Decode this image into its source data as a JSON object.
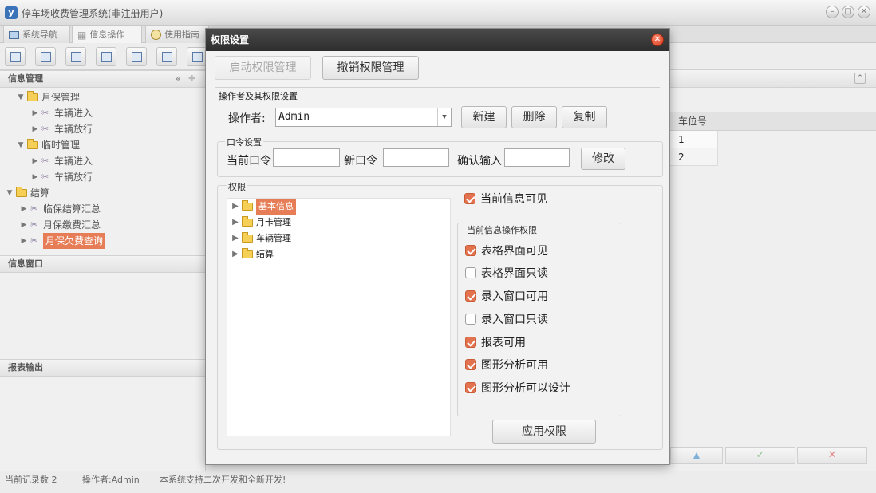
{
  "window": {
    "title": "停车场收费管理系统(非注册用户)",
    "app_icon": "y",
    "tabs": [
      {
        "label": "系统导航",
        "icon": "monitor-icon"
      },
      {
        "label": "信息操作",
        "icon": "grid-icon"
      },
      {
        "label": "使用指南",
        "icon": "clock-icon"
      }
    ]
  },
  "left": {
    "panel1_title": "信息管理",
    "panel2_title": "信息窗口",
    "panel3_title": "报表输出",
    "tree": {
      "monthly": "月保管理",
      "monthly_in": "车辆进入",
      "monthly_out": "车辆放行",
      "temp": "临时管理",
      "temp_in": "车辆进入",
      "temp_out": "车辆放行",
      "settle": "结算",
      "settle_temp": "临保结算汇总",
      "settle_monthly": "月保缴费汇总",
      "settle_arrears": "月保欠费查询"
    }
  },
  "right": {
    "column_header": "车位号",
    "rows": [
      "1",
      "2"
    ]
  },
  "statusbar": {
    "records": "当前记录数 2",
    "operator": "操作者:Admin",
    "note": "本系统支持二次开发和全新开发!"
  },
  "dialog": {
    "title": "权限设置",
    "btn_enable": "启动权限管理",
    "btn_disable": "撤销权限管理",
    "section_operator": "操作者及其权限设置",
    "operator_label": "操作者:",
    "operator_value": "Admin",
    "btn_new": "新建",
    "btn_delete": "删除",
    "btn_copy": "复制",
    "password_group": "口令设置",
    "current_pw": "当前口令",
    "new_pw": "新口令",
    "confirm_pw": "确认输入",
    "btn_modify": "修改",
    "perm_group": "权限",
    "perm_tree": [
      "基本信息",
      "月卡管理",
      "车辆管理",
      "结算"
    ],
    "visible_label": "当前信息可见",
    "visible_checked": true,
    "ops_group": "当前信息操作权限",
    "ops": [
      {
        "label": "表格界面可见",
        "checked": true
      },
      {
        "label": "表格界面只读",
        "checked": false
      },
      {
        "label": "录入窗口可用",
        "checked": true
      },
      {
        "label": "录入窗口只读",
        "checked": false
      },
      {
        "label": "报表可用",
        "checked": true
      },
      {
        "label": "图形分析可用",
        "checked": true
      },
      {
        "label": "图形分析可以设计",
        "checked": true
      }
    ],
    "btn_apply": "应用权限"
  }
}
